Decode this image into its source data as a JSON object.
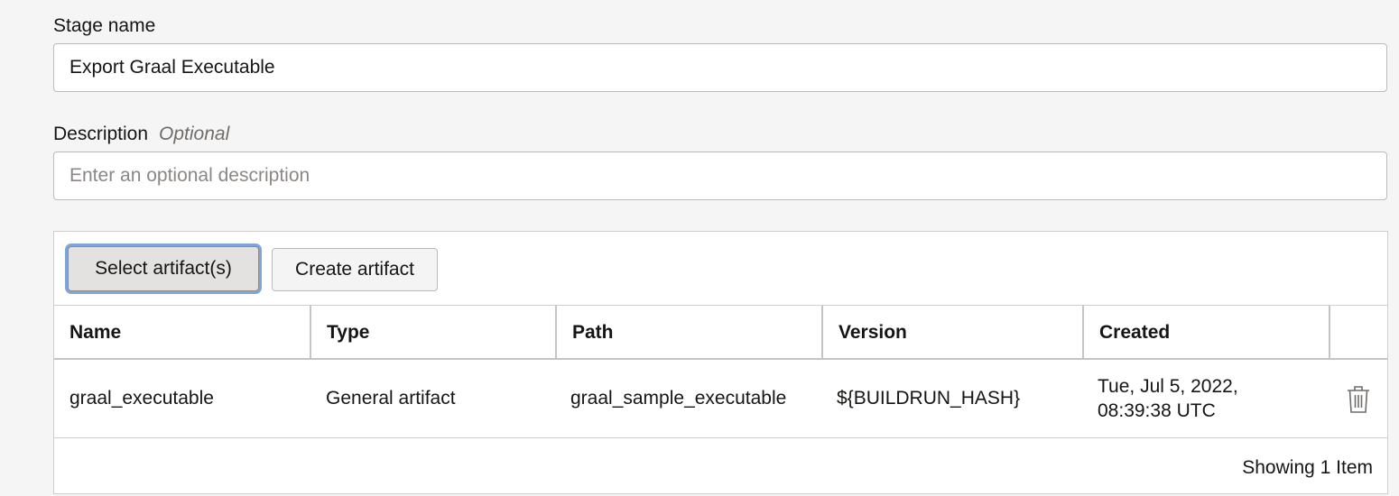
{
  "stage_name": {
    "label": "Stage name",
    "value": "Export Graal Executable"
  },
  "description": {
    "label": "Description",
    "optional_tag": "Optional",
    "placeholder": "Enter an optional description",
    "value": ""
  },
  "toolbar": {
    "select_label": "Select artifact(s)",
    "create_label": "Create artifact"
  },
  "table": {
    "headers": {
      "name": "Name",
      "type": "Type",
      "path": "Path",
      "version": "Version",
      "created": "Created"
    },
    "rows": [
      {
        "name": "graal_executable",
        "type": "General artifact",
        "path": "graal_sample_executable",
        "version": "${BUILDRUN_HASH}",
        "created_line1": "Tue, Jul 5, 2022,",
        "created_line2": "08:39:38 UTC",
        "action_icon": "trash-icon"
      }
    ],
    "footer": "Showing 1 Item"
  },
  "colors": {
    "background": "#f5f5f5",
    "focus_ring": "#7ea6d8",
    "text": "#161513",
    "muted": "#6f6c6a"
  }
}
